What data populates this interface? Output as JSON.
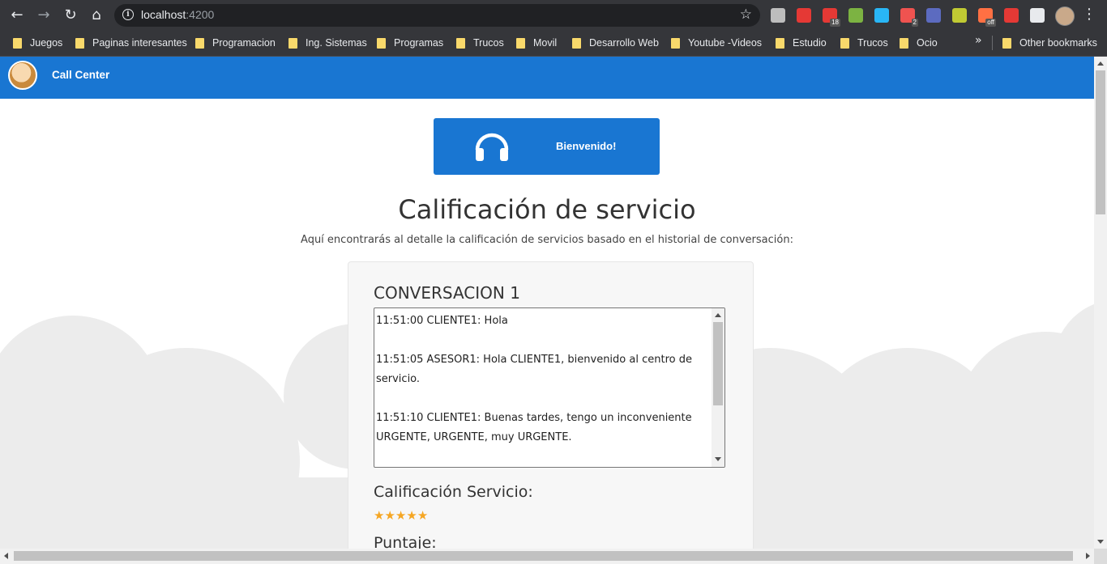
{
  "browser": {
    "url_host": "localhost",
    "url_port": ":4200",
    "extensions": [
      {
        "name": "camera-icon",
        "color": "#bdbdbd"
      },
      {
        "name": "stop-hand-icon",
        "color": "#e53935"
      },
      {
        "name": "calendar-icon",
        "color": "#e53935",
        "badge": "18"
      },
      {
        "name": "color-ring-icon",
        "color": "#7cb342"
      },
      {
        "name": "screen-capture-icon",
        "color": "#29b6f6"
      },
      {
        "name": "tag-icon",
        "color": "#ef5350",
        "badge": "2"
      },
      {
        "name": "keyboard-icon",
        "color": "#5c6bc0"
      },
      {
        "name": "leaf-icon",
        "color": "#c0ca33"
      },
      {
        "name": "cam-off-icon",
        "color": "#ff7043",
        "badge": "off"
      },
      {
        "name": "fast-forward-icon",
        "color": "#e53935"
      },
      {
        "name": "puzzle-icon",
        "color": "#e8eaed"
      }
    ]
  },
  "bookmarks": {
    "items": [
      "Juegos",
      "Paginas interesantes",
      "Programacion",
      "Ing. Sistemas",
      "Programas",
      "Trucos",
      "Movil",
      "Desarrollo Web",
      "Youtube -Videos",
      "Estudio",
      "Trucos",
      "Ocio"
    ],
    "more": "»",
    "other": "Other bookmarks"
  },
  "app": {
    "title": "Call Center",
    "welcome": "Bienvenido!",
    "page_title": "Calificación de servicio",
    "page_subtitle": "Aquí encontrarás al detalle la calificación de servicios basado en el historial de conversación:",
    "conversation": {
      "title": "CONVERSACION 1",
      "lines": [
        "11:51:00 CLIENTE1: Hola",
        "11:51:05 ASESOR1: Hola CLIENTE1, bienvenido al centro de servicio.",
        "11:51:10 CLIENTE1: Buenas tardes, tengo un inconveniente URGENTE, URGENTE, muy URGENTE."
      ]
    },
    "rating_label": "Calificación Servicio:",
    "stars": 5,
    "score_label": "Puntaje:"
  },
  "colors": {
    "header_blue": "#1976d2",
    "chrome_dark": "#35363a",
    "star_gold": "#f5a623",
    "cloud_gray": "#ececec"
  }
}
